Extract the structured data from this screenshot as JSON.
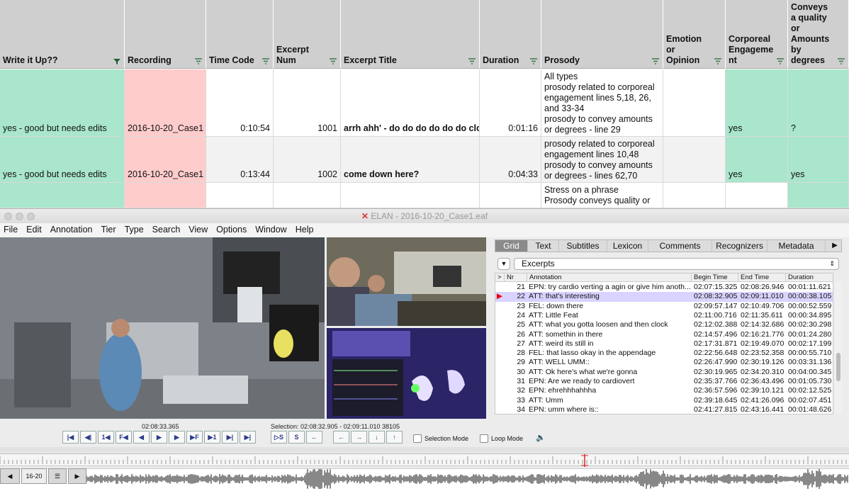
{
  "sheet": {
    "headers": [
      "Write it Up??",
      "Recording",
      "Time Code",
      "Excerpt Num",
      "Excerpt Title",
      "Duration",
      "Prosody",
      "Emotion\nor Opinion",
      "Corporeal\nEngageme\nnt",
      "Conveys\na quality\nor\nAmounts\nby\ndegrees"
    ],
    "rows": [
      {
        "write": "yes - good but needs edits",
        "recording": "2016-10-20_Case1",
        "timecode": "0:10:54",
        "num": "1001",
        "title": "arrh ahh' - do do do do do do clock",
        "duration": "0:01:16",
        "prosody": "All types\nprosody related to corporeal engagement lines  5,18, 26, and 33-34\nprosody to convey amounts or degrees - line 29",
        "emotion": "",
        "corporeal": "yes",
        "conveys": "?"
      },
      {
        "write": "yes - good but needs edits",
        "recording": "2016-10-20_Case1",
        "timecode": "0:13:44",
        "num": "1002",
        "title": "come down here?",
        "duration": "0:04:33",
        "prosody": "prosody related to corporeal engagement lines 10,48\nprosody to convey amounts or degrees - lines 62,70",
        "emotion": "",
        "corporeal": "yes",
        "conveys": "yes"
      },
      {
        "write": "",
        "recording": "",
        "timecode": "",
        "num": "",
        "title": "",
        "duration": "",
        "prosody": "Stress on a phrase\nProsody conveys quality or",
        "emotion": "",
        "corporeal": "",
        "conveys": ""
      }
    ]
  },
  "elan": {
    "title": "ELAN - 2016-10-20_Case1.eaf",
    "menu": [
      "File",
      "Edit",
      "Annotation",
      "Tier",
      "Type",
      "Search",
      "View",
      "Options",
      "Window",
      "Help"
    ],
    "current_time": "02:08:33.365",
    "selection": "Selection: 02:08:32.905 - 02:09:11.010  38105",
    "controls": [
      "|◀",
      "◀|",
      "1◀",
      "F◀",
      "◀",
      "▶",
      "▶",
      "▶F",
      "▶1",
      "▶|",
      "▶|"
    ],
    "sel_controls": [
      "▷S",
      "S",
      "←"
    ],
    "arrow_controls": [
      "←",
      "→",
      "↓",
      "↑"
    ],
    "selection_mode": "Selection Mode",
    "loop_mode": "Loop Mode",
    "tabs": [
      "Grid",
      "Text",
      "Subtitles",
      "Lexicon",
      "Comments",
      "Recognizers",
      "Metadata"
    ],
    "tier": "Excerpts",
    "grid_headers": [
      ">",
      "Nr",
      "Annotation",
      "Begin Time",
      "End Time",
      "Duration"
    ],
    "annotations": [
      {
        "nr": "21",
        "text": "EPN: try cardio verting a agin or give him anoth...",
        "begin": "02:07:15.325",
        "end": "02:08:26.946",
        "dur": "00:01:11.621"
      },
      {
        "nr": "22",
        "text": "ATT: that's interesting",
        "begin": "02:08:32.905",
        "end": "02:09:11.010",
        "dur": "00:00:38.105"
      },
      {
        "nr": "23",
        "text": "FEL: down there",
        "begin": "02:09:57.147",
        "end": "02:10:49.706",
        "dur": "00:00:52.559"
      },
      {
        "nr": "24",
        "text": "ATT: Little Feat",
        "begin": "02:11:00.716",
        "end": "02:11:35.611",
        "dur": "00:00:34.895"
      },
      {
        "nr": "25",
        "text": "ATT: what you gotta loosen and then clock",
        "begin": "02:12:02.388",
        "end": "02:14:32.686",
        "dur": "00:02:30.298"
      },
      {
        "nr": "26",
        "text": "ATT: somethin in there",
        "begin": "02:14:57.496",
        "end": "02:16:21.776",
        "dur": "00:01:24.280"
      },
      {
        "nr": "27",
        "text": "ATT: weird its still in",
        "begin": "02:17:31.871",
        "end": "02:19:49.070",
        "dur": "00:02:17.199"
      },
      {
        "nr": "28",
        "text": "FEL: that lasso okay in the appendage",
        "begin": "02:22:56.648",
        "end": "02:23:52.358",
        "dur": "00:00:55.710"
      },
      {
        "nr": "29",
        "text": "ATT: WELL UMM::",
        "begin": "02:26:47.990",
        "end": "02:30:19.126",
        "dur": "00:03:31.136"
      },
      {
        "nr": "30",
        "text": "ATT: Ok here's what we're gonna",
        "begin": "02:30:19.965",
        "end": "02:34:20.310",
        "dur": "00:04:00.345"
      },
      {
        "nr": "31",
        "text": "EPN: Are we ready to cardiovert",
        "begin": "02:35:37.766",
        "end": "02:36:43.496",
        "dur": "00:01:05.730"
      },
      {
        "nr": "32",
        "text": "EPN: ehrehhhahhha",
        "begin": "02:36:57.596",
        "end": "02:39:10.121",
        "dur": "00:02:12.525"
      },
      {
        "nr": "33",
        "text": "ATT: Umm",
        "begin": "02:39:18.645",
        "end": "02:41:26.096",
        "dur": "00:02:07.451"
      },
      {
        "nr": "34",
        "text": "EPN: umm where is::",
        "begin": "02:41:27.815",
        "end": "02:43:16.441",
        "dur": "00:01:48.626"
      }
    ],
    "selected_nr": "22",
    "nav_label": "16-",
    "nav_label2": "20",
    "colors": {
      "green": "#a9e6cc",
      "pink": "#ffcccc",
      "selected": "#d8d3ff"
    }
  }
}
